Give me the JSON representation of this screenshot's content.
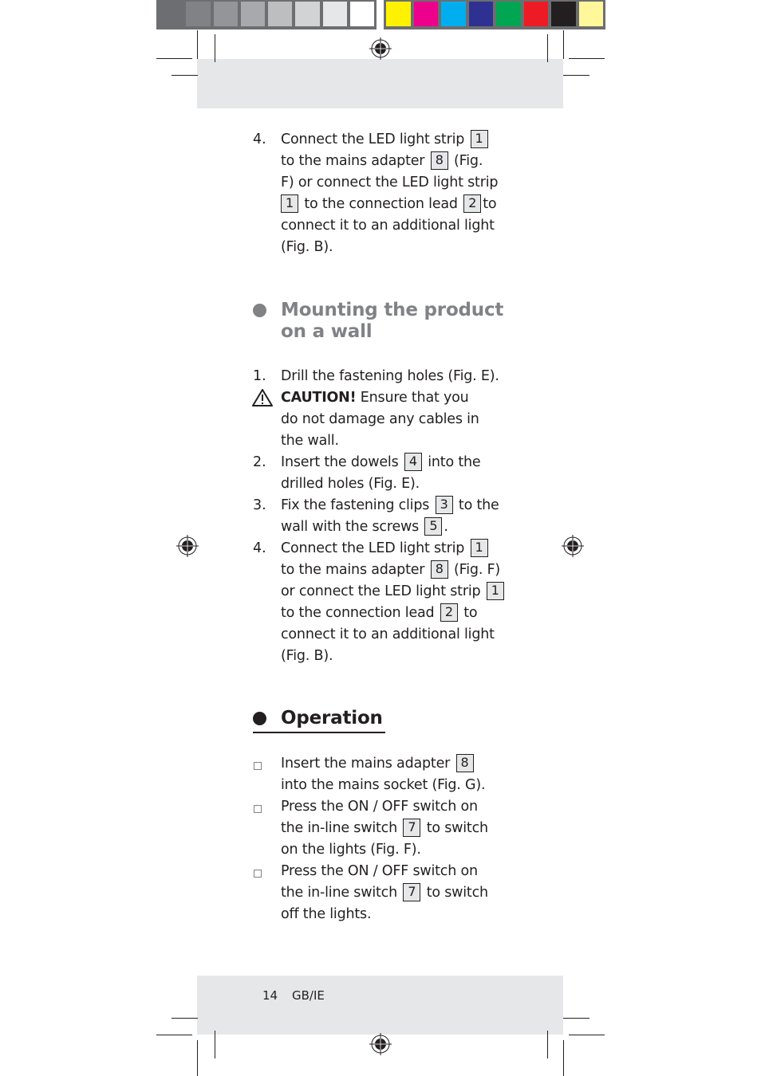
{
  "print_marks": {
    "gray_swatches": [
      "#6d6e71",
      "#808285",
      "#939598",
      "#a7a9ac",
      "#bcbec0",
      "#d1d3d4",
      "#e6e7e8",
      "#ffffff"
    ],
    "color_swatches": [
      "#fff200",
      "#ec008c",
      "#00aeef",
      "#2e3192",
      "#00a651",
      "#ed1c24",
      "#231f20",
      "#fff799"
    ]
  },
  "colors": {
    "text": "#231f20",
    "heading_gray": "#808285",
    "band": "#e6e7e8"
  },
  "sections": {
    "prev_step4": {
      "number": "4.",
      "lines": [
        {
          "pre": "Connect the LED light strip",
          "ref": "1",
          "post": ""
        },
        {
          "pre": "to the mains adapter",
          "ref": "8",
          "post": "(Fig."
        },
        {
          "pre": "F) or connect the LED light strip",
          "ref": "",
          "post": ""
        },
        {
          "pre": "",
          "ref": "1",
          "post": "to the connection lead",
          "ref2": "2",
          "post2": "to"
        },
        {
          "pre": "connect it to an additional light",
          "ref": "",
          "post": ""
        },
        {
          "pre": "(Fig. B).",
          "ref": "",
          "post": ""
        }
      ]
    },
    "mounting": {
      "title_line1": "Mounting the product",
      "title_line2": "on a wall",
      "step1": {
        "number": "1.",
        "text": "Drill the fastening holes (Fig. E)."
      },
      "caution": {
        "label": "CAUTION!",
        "line1": "Ensure that you",
        "line2": "do not damage any cables in",
        "line3": "the wall."
      },
      "step2": {
        "number": "2.",
        "pre": "Insert the dowels",
        "ref": "4",
        "post": "into the",
        "line2": "drilled holes (Fig. E)."
      },
      "step3": {
        "number": "3.",
        "pre": "Fix the fastening clips",
        "ref": "3",
        "post": "to the",
        "line2_pre": "wall with the screws",
        "line2_ref": "5",
        "line2_post": "."
      },
      "step4": {
        "number": "4.",
        "l1_pre": "Connect the LED light strip",
        "l1_ref": "1",
        "l2_pre": "to the mains adapter",
        "l2_ref": "8",
        "l2_post": "(Fig. F)",
        "l3_pre": "or connect the LED light strip",
        "l3_ref": "1",
        "l4_pre": "to the connection lead",
        "l4_ref": "2",
        "l4_post": "to",
        "l5": "connect it to an additional light",
        "l6": "(Fig. B)."
      }
    },
    "operation": {
      "title": "Operation",
      "item1": {
        "pre": "Insert the mains adapter",
        "ref": "8",
        "line2": "into the mains socket (Fig. G)."
      },
      "item2": {
        "line1": "Press the ON / OFF switch on",
        "l2_pre": "the in-line switch",
        "l2_ref": "7",
        "l2_post": "to switch",
        "line3": "on the lights (Fig. F)."
      },
      "item3": {
        "line1": "Press the ON / OFF switch on",
        "l2_pre": "the in-line switch",
        "l2_ref": "7",
        "l2_post": "to switch",
        "line3": "off the lights."
      }
    }
  },
  "footer": {
    "page_number": "14",
    "locale": "GB/IE"
  }
}
